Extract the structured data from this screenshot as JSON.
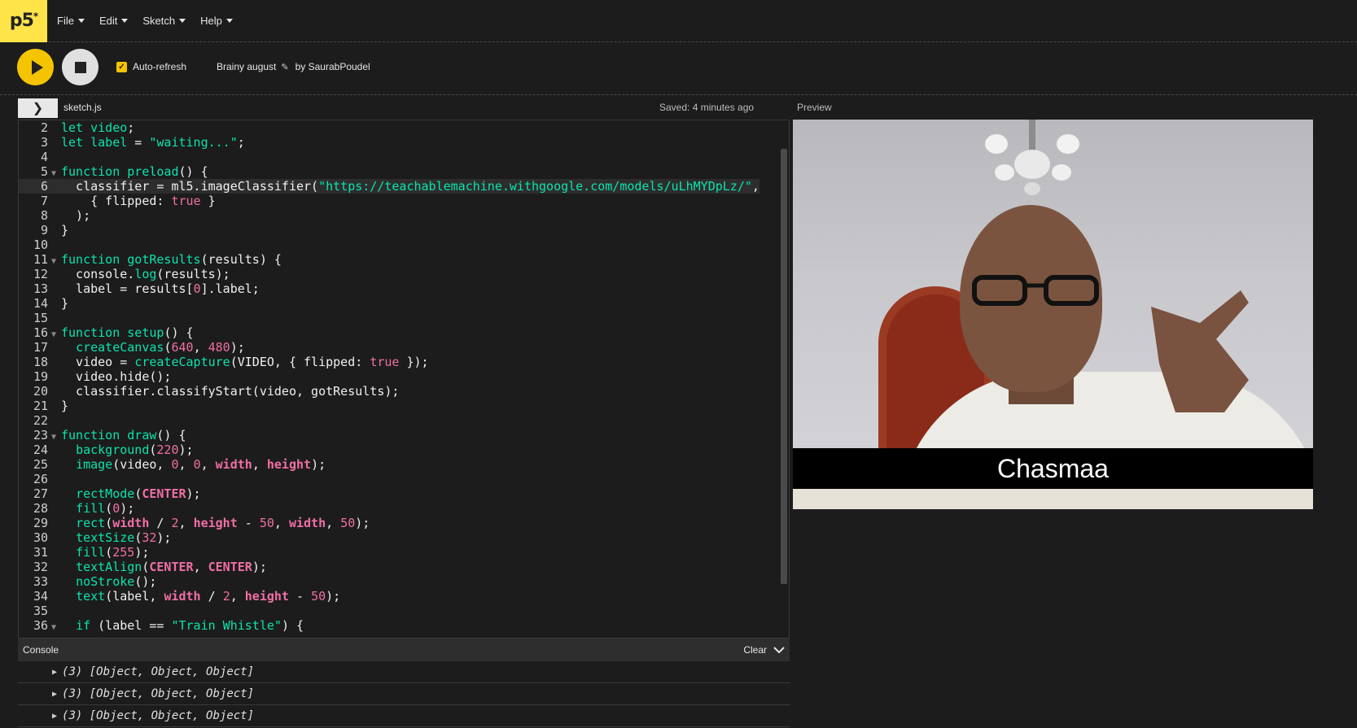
{
  "nav": {
    "logo": "p5",
    "logo_mark": "*",
    "menu": [
      {
        "label": "File"
      },
      {
        "label": "Edit"
      },
      {
        "label": "Sketch"
      },
      {
        "label": "Help"
      }
    ]
  },
  "toolbar": {
    "auto_refresh_label": "Auto-refresh",
    "auto_refresh_checked": true,
    "project_name": "Brainy august",
    "author": "by SaurabPoudel"
  },
  "editor": {
    "file_name": "sketch.js",
    "saved_status": "Saved: 4 minutes ago",
    "preview_label": "Preview"
  },
  "code": {
    "l2_n": "2",
    "l3_n": "3",
    "l4_n": "4",
    "l5_n": "5",
    "l6_n": "6",
    "l7_n": "7",
    "l8_n": "8",
    "l9_n": "9",
    "l10_n": "10",
    "l11_n": "11",
    "l12_n": "12",
    "l13_n": "13",
    "l14_n": "14",
    "l15_n": "15",
    "l16_n": "16",
    "l17_n": "17",
    "l18_n": "18",
    "l19_n": "19",
    "l20_n": "20",
    "l21_n": "21",
    "l22_n": "22",
    "l23_n": "23",
    "l24_n": "24",
    "l25_n": "25",
    "l26_n": "26",
    "l27_n": "27",
    "l28_n": "28",
    "l29_n": "29",
    "l30_n": "30",
    "l31_n": "31",
    "l32_n": "32",
    "l33_n": "33",
    "l34_n": "34",
    "l35_n": "35",
    "l36_n": "36",
    "url": "\"https://teachablemachine.withgoogle.com/models/uLhMYDpLz/\"",
    "waiting": "\"waiting...\"",
    "train_whistle": "\"Train Whistle\""
  },
  "console": {
    "title": "Console",
    "clear_label": "Clear",
    "rows": [
      {
        "text": "(3) [Object, Object, Object]"
      },
      {
        "text": "(3) [Object, Object, Object]"
      },
      {
        "text": "(3) [Object, Object, Object]"
      }
    ]
  },
  "preview": {
    "classification_label": "Chasmaa"
  },
  "colors": {
    "accent": "#f5c400",
    "code_keyword": "#0ce3ac",
    "code_number": "#f06fa5",
    "background": "#1c1c1c"
  }
}
